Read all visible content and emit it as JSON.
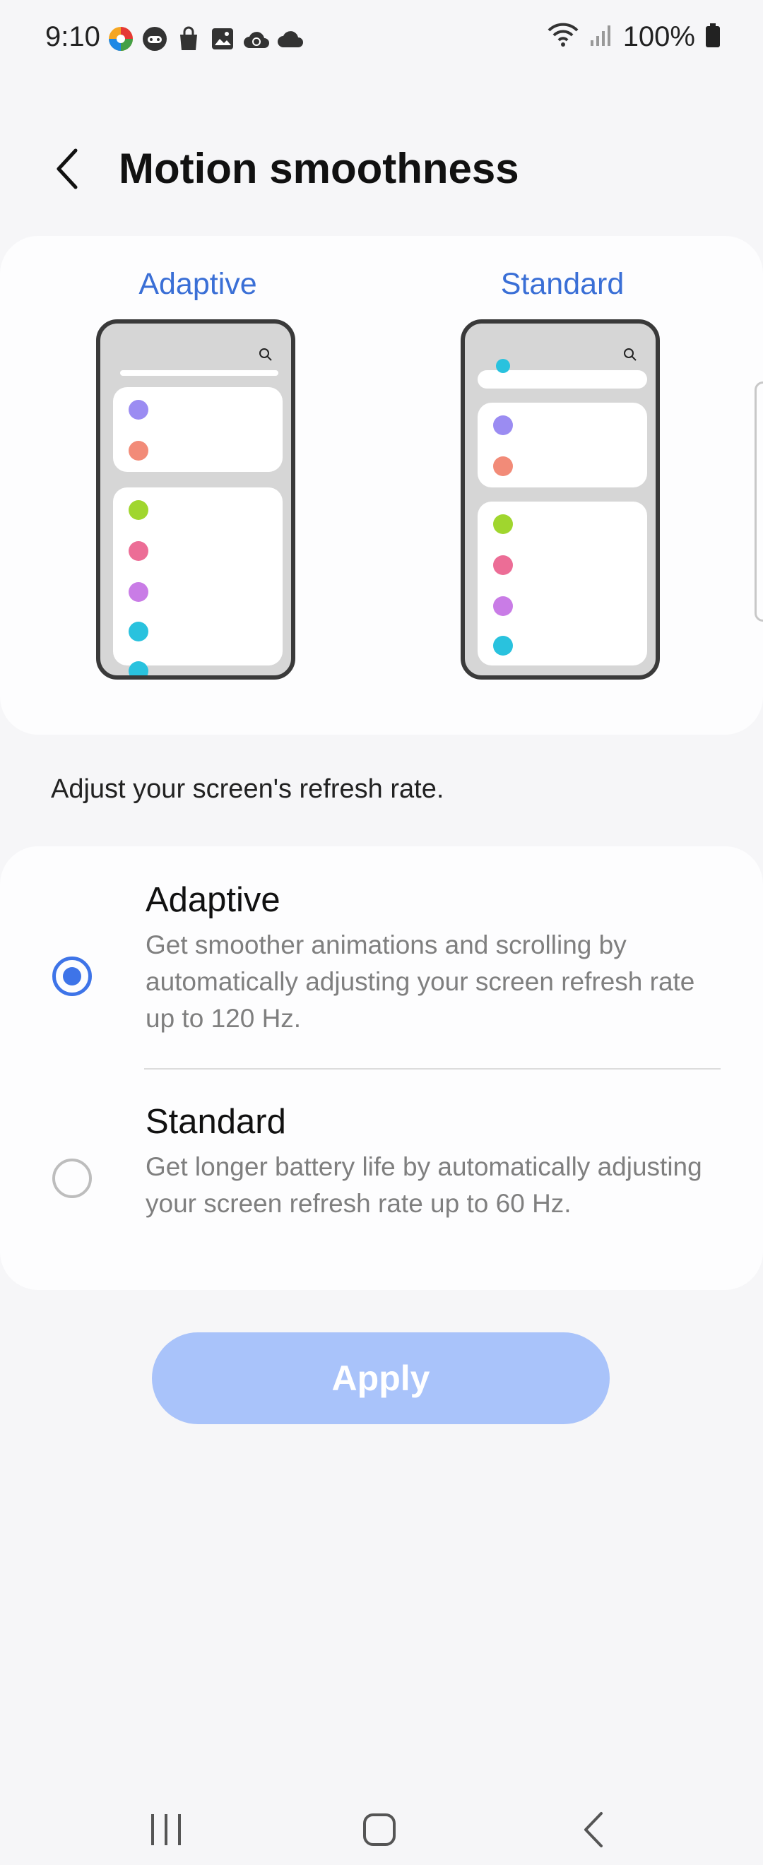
{
  "status_bar": {
    "time": "9:10",
    "battery_text": "100%",
    "left_icons": [
      "pinwheel-app-icon",
      "gamepad-icon",
      "shopping-bag-icon",
      "gallery-icon",
      "cloud-sync-icon",
      "cloud-icon"
    ],
    "right_icons": [
      "wifi-icon",
      "signal-icon",
      "battery-icon"
    ]
  },
  "header": {
    "title": "Motion smoothness",
    "back_icon": "chevron-left-icon"
  },
  "preview": {
    "adaptive_label": "Adaptive",
    "standard_label": "Standard",
    "dot_colors": [
      "#9b8cf2",
      "#f28b78",
      "#a0d62e",
      "#ec6d96",
      "#c97ce6",
      "#29c2de"
    ]
  },
  "description": "Adjust your screen's refresh rate.",
  "options": [
    {
      "title": "Adaptive",
      "description": "Get smoother animations and scrolling by automatically adjusting your screen refresh rate up to 120 Hz.",
      "selected": true
    },
    {
      "title": "Standard",
      "description": "Get longer battery life by automatically adjusting your screen refresh rate up to 60 Hz.",
      "selected": false
    }
  ],
  "apply_label": "Apply",
  "colors": {
    "accent": "#3e74e8",
    "apply_disabled": "#a9c3fa",
    "preview_label": "#3a6fd6"
  },
  "nav_bar": [
    "recents-icon",
    "home-icon",
    "back-icon"
  ]
}
